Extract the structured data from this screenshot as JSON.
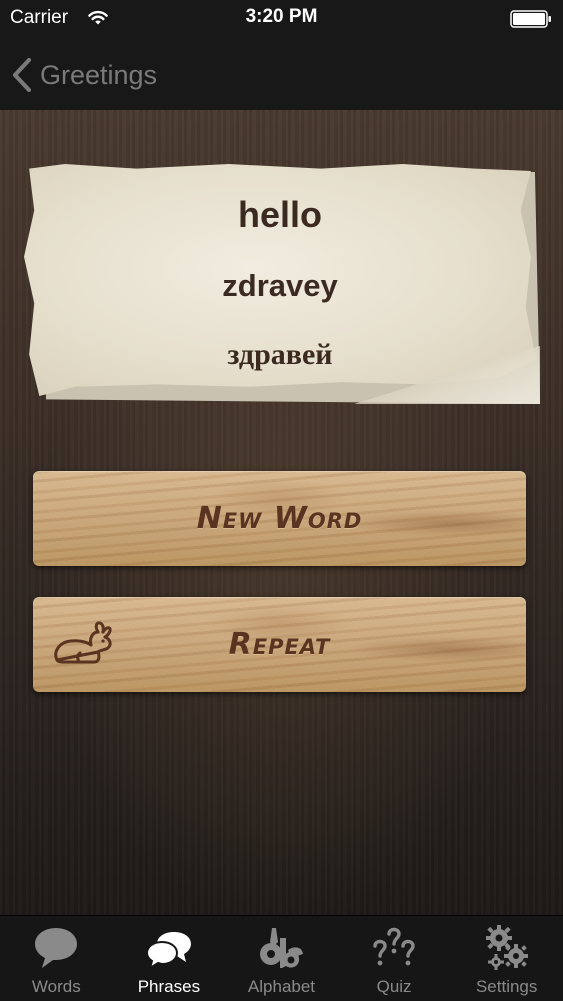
{
  "status_bar": {
    "carrier": "Carrier",
    "time": "3:20 PM"
  },
  "nav": {
    "back_label": "Greetings"
  },
  "card": {
    "english": "hello",
    "transliteration": "zdravey",
    "native": "здравей"
  },
  "buttons": {
    "new_word": "New Word",
    "repeat": "Repeat"
  },
  "tabs": [
    {
      "label": "Words",
      "icon": "speech-bubble-icon",
      "active": false
    },
    {
      "label": "Phrases",
      "icon": "speech-bubbles-icon",
      "active": true
    },
    {
      "label": "Alphabet",
      "icon": "alphabet-icon",
      "active": false
    },
    {
      "label": "Quiz",
      "icon": "question-marks-icon",
      "active": false
    },
    {
      "label": "Settings",
      "icon": "gears-icon",
      "active": false
    }
  ],
  "colors": {
    "nav_background": "#181818",
    "back_label": "#7a7a7a",
    "tab_active": "#ffffff",
    "tab_inactive": "#8a8a8a",
    "ink": "#3b2a20",
    "wood_label": "#5a3420"
  }
}
